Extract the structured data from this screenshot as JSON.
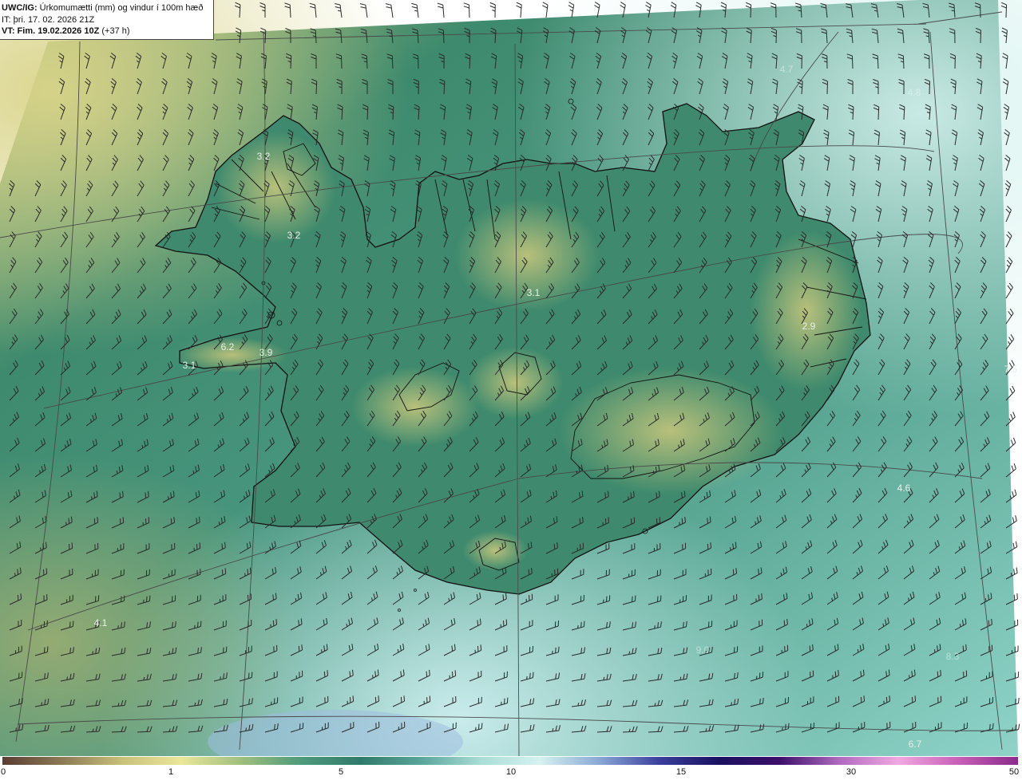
{
  "header": {
    "title_code": "UWC/IG:",
    "title_text": "Úrkomumætti (mm) og vindur í 100m hæð",
    "initial_time": "IT: þri. 17. 02. 2026 21Z",
    "valid_code": "VT: Fim. 19.02.2026 10Z",
    "valid_offset": "(+37 h)"
  },
  "map_labels": [
    {
      "text": "3.2",
      "faint": false
    },
    {
      "text": "3.2",
      "faint": false
    },
    {
      "text": "6.2",
      "faint": false
    },
    {
      "text": "3.9",
      "faint": false
    },
    {
      "text": "3.1",
      "faint": false
    },
    {
      "text": "3.1",
      "faint": false
    },
    {
      "text": "2.9",
      "faint": false
    },
    {
      "text": "7.5",
      "faint": false
    },
    {
      "text": "4.6",
      "faint": false
    },
    {
      "text": "4.1",
      "faint": false
    },
    {
      "text": "6.7",
      "faint": false
    },
    {
      "text": "4.7",
      "faint": true
    },
    {
      "text": "4.8",
      "faint": true
    },
    {
      "text": "8.3",
      "faint": true
    },
    {
      "text": "9.0",
      "faint": true
    }
  ],
  "colorbar": {
    "ticks": [
      "0",
      "1",
      "5",
      "10",
      "15",
      "30",
      "50"
    ],
    "colors": [
      "#5a3d33",
      "#8c7a55",
      "#c9c07a",
      "#e9e79a",
      "#9fbf7d",
      "#4f9a7c",
      "#2f7a6a",
      "#5aa59a",
      "#a9ddd6",
      "#d6f2f0",
      "#8aa7d6",
      "#3a3f9c",
      "#1a1060",
      "#3c0f6a",
      "#b06ac0",
      "#f0a8e0",
      "#c860b8",
      "#8a2a8a"
    ]
  },
  "colors": {
    "coast": "#111111",
    "grid": "#4a4a4a",
    "barb": "#2a2a2a"
  }
}
